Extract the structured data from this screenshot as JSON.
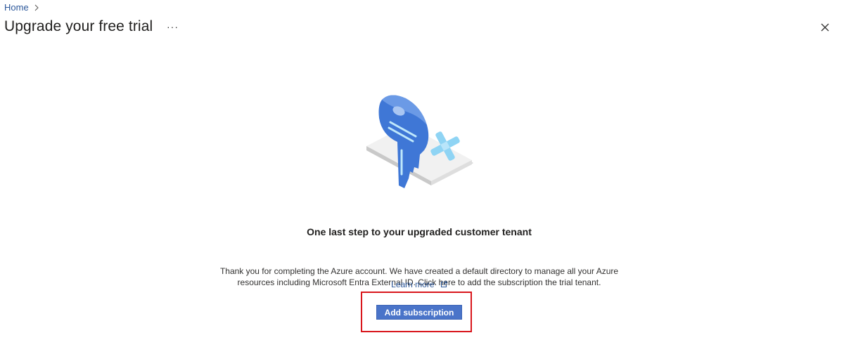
{
  "breadcrumb": {
    "home_label": "Home"
  },
  "header": {
    "title": "Upgrade your free trial",
    "more_label": "···"
  },
  "illustration": {
    "icon_name": "key-icon"
  },
  "main": {
    "heading": "One last step to your upgraded customer tenant",
    "description": "Thank you for completing the Azure account. We have created a default directory to manage all your Azure resources including Microsoft Entra External ID. Click here to add the subscription the trial tenant.",
    "learn_more_label": "Learn more",
    "button_label": "Add subscription"
  },
  "colors": {
    "link": "#2b579a",
    "primary_button": "#4a74c9",
    "highlight": "#d9161c"
  }
}
